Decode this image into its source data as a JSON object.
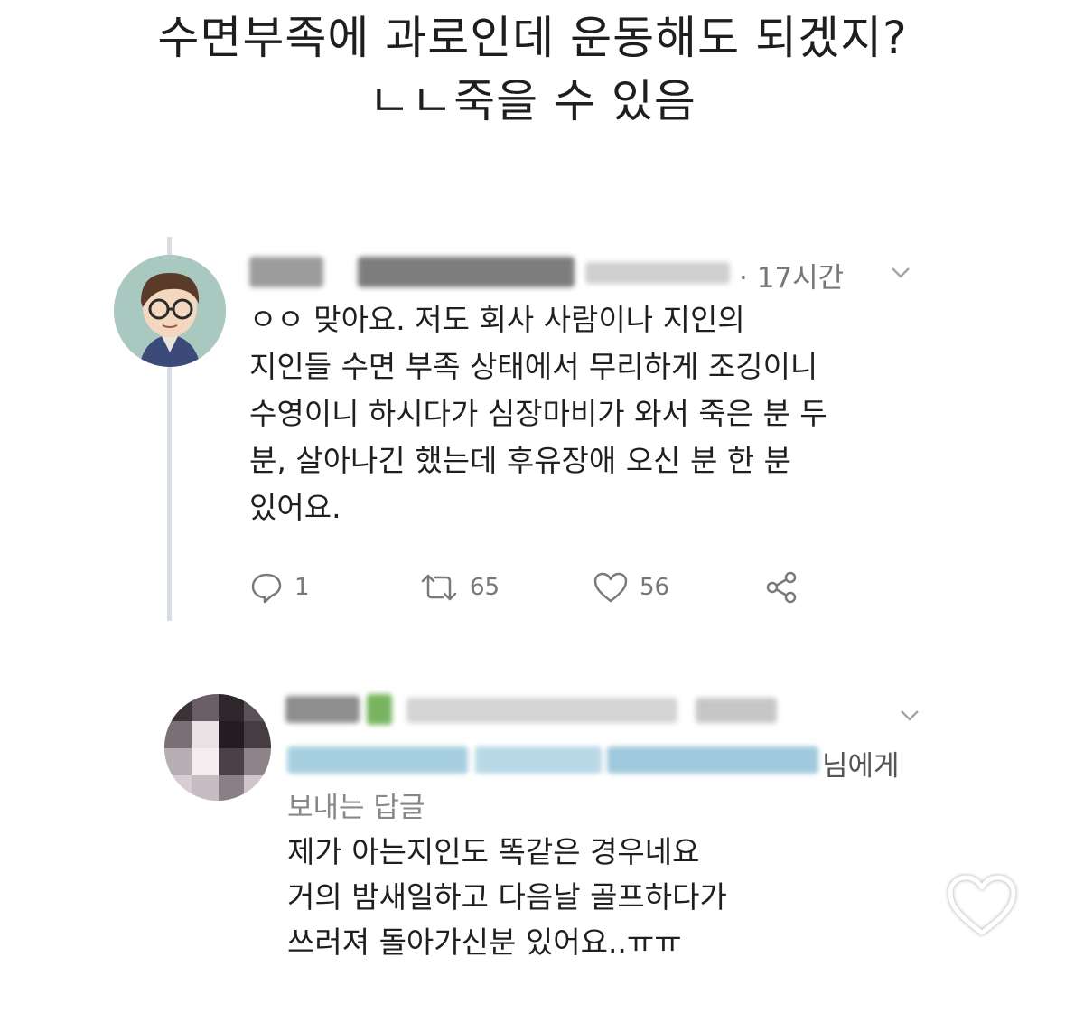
{
  "headline": {
    "line1": "수면부족에 과로인데 운동해도 되겠지?",
    "line2": "ㄴㄴ죽을 수 있음"
  },
  "tweet": {
    "time": "· 17시간",
    "lines": [
      "ㅇㅇ 맞아요. 저도 회사 사람이나 지인의",
      "지인들 수면 부족 상태에서 무리하게 조깅이니",
      "수영이니 하시다가 심장마비가 와서 죽은 분 두",
      "분, 살아나긴 했는데 후유장애 오신 분 한 분",
      "있어요."
    ],
    "reply_count": "1",
    "retweet_count": "65",
    "like_count": "56"
  },
  "reply": {
    "recipient_suffix": "님에게",
    "label": "보내는 답글",
    "lines": [
      "제가 아는지인도 똑같은 경우네요",
      "거의 밤새일하고 다음날 골프하다가",
      "쓰러져 돌아가신분 있어요..ㅠㅠ"
    ]
  },
  "icons": {
    "reply": "comment-icon",
    "retweet": "retweet-icon",
    "like": "heart-icon",
    "share": "share-icon",
    "more": "chevron-down-icon",
    "overlay": "heart-outline-icon"
  }
}
